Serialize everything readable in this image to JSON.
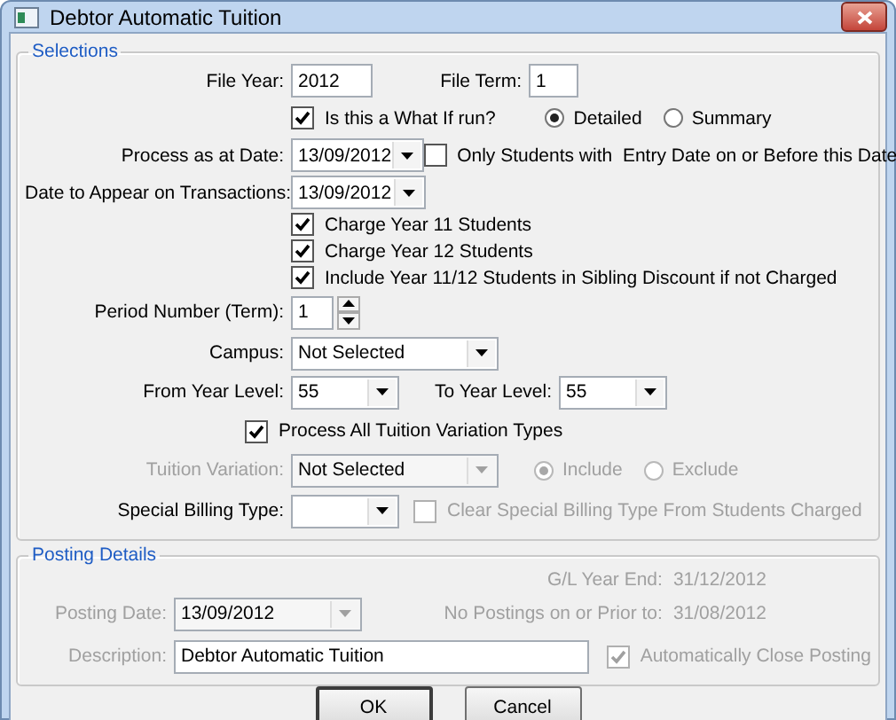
{
  "window": {
    "title": "Debtor Automatic Tuition"
  },
  "selections": {
    "title": "Selections",
    "file_year": {
      "label": "File Year:",
      "value": "2012"
    },
    "file_term": {
      "label": "File Term:",
      "value": "1"
    },
    "what_if": {
      "label": "Is this a What If run?",
      "checked": true
    },
    "report_mode": [
      {
        "label": "Detailed",
        "selected": true
      },
      {
        "label": "Summary",
        "selected": false
      }
    ],
    "process_date": {
      "label": "Process as at Date:",
      "value": "13/09/2012"
    },
    "entry_date_only": {
      "label": "Only Students with  Entry Date on or Before this Date",
      "checked": false
    },
    "transaction_date": {
      "label": "Date to Appear on Transactions:",
      "value": "13/09/2012"
    },
    "charge_options": [
      {
        "label": "Charge Year 11 Students",
        "checked": true
      },
      {
        "label": "Charge Year 12 Students",
        "checked": true
      },
      {
        "label": "Include Year 11/12 Students in Sibling Discount if not Charged",
        "checked": true
      }
    ],
    "period_number": {
      "label": "Period Number (Term):",
      "value": "1"
    },
    "campus": {
      "label": "Campus:",
      "value": "Not Selected"
    },
    "from_year_level": {
      "label": "From Year Level:",
      "value": "55"
    },
    "to_year_level": {
      "label": "To Year Level:",
      "value": "55"
    },
    "all_variation_types": {
      "label": "Process All Tuition Variation Types",
      "checked": true
    },
    "tuition_variation": {
      "label": "Tuition Variation:",
      "value": "Not Selected",
      "disabled": true
    },
    "variation_mode": [
      {
        "label": "Include",
        "selected": true,
        "disabled": true
      },
      {
        "label": "Exclude",
        "selected": false,
        "disabled": true
      }
    ],
    "special_billing": {
      "label": "Special Billing Type:"
    },
    "clear_special_billing": {
      "label": "Clear Special Billing Type From Students Charged",
      "checked": false,
      "disabled": true
    }
  },
  "posting": {
    "title": "Posting Details",
    "gl_year_end": {
      "label": "G/L Year End:",
      "value": "31/12/2012"
    },
    "no_postings_before": {
      "label": "No Postings on or Prior to:",
      "value": "31/08/2012"
    },
    "posting_date": {
      "label": "Posting Date:",
      "value": "13/09/2012",
      "disabled": true
    },
    "description": {
      "label": "Description:",
      "value": "Debtor Automatic Tuition",
      "disabled": true
    },
    "auto_close": {
      "label": "Automatically Close Posting",
      "checked": true,
      "disabled": true
    }
  },
  "buttons": [
    {
      "label": "OK",
      "default": true
    },
    {
      "label": "Cancel",
      "default": false
    }
  ]
}
